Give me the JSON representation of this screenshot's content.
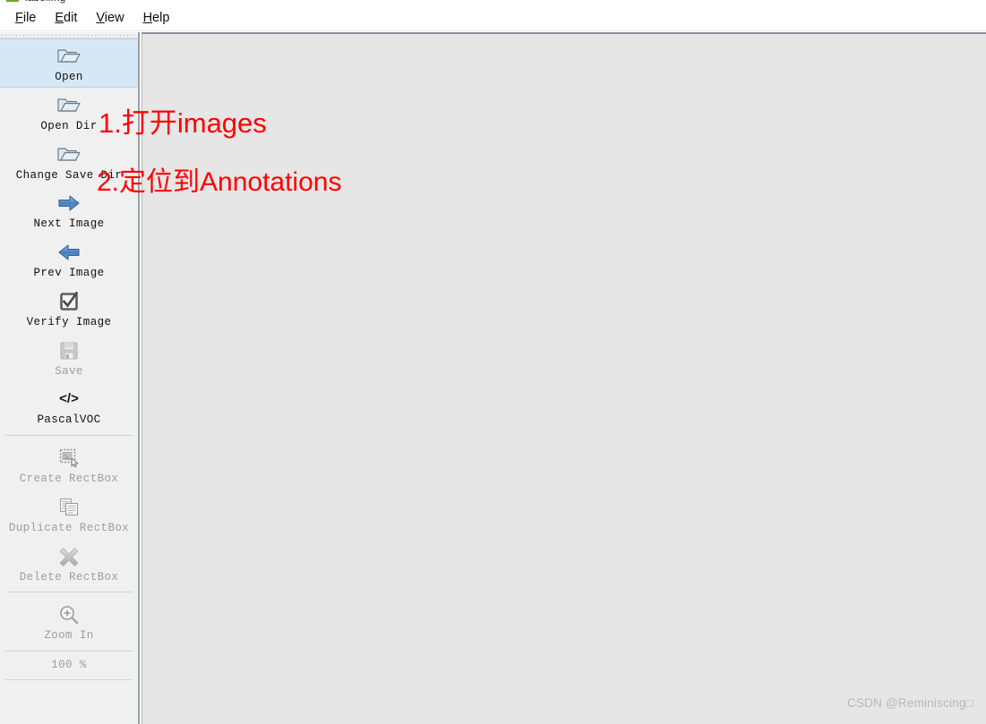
{
  "window": {
    "title": "labelImg",
    "icon": "labelimg-logo-icon"
  },
  "menubar": {
    "items": [
      {
        "label": "File",
        "mnemonic": "F"
      },
      {
        "label": "Edit",
        "mnemonic": "E"
      },
      {
        "label": "View",
        "mnemonic": "V"
      },
      {
        "label": "Help",
        "mnemonic": "H"
      }
    ]
  },
  "toolbar": {
    "items": [
      {
        "label": "Open",
        "icon": "open-folder-icon",
        "enabled": true,
        "selected": true
      },
      {
        "label": "Open Dir",
        "icon": "open-folder-icon",
        "enabled": true,
        "selected": false
      },
      {
        "label": "Change Save Dir",
        "icon": "open-folder-icon",
        "enabled": true,
        "selected": false
      },
      {
        "label": "Next Image",
        "icon": "arrow-right-icon",
        "enabled": true,
        "selected": false
      },
      {
        "label": "Prev Image",
        "icon": "arrow-left-icon",
        "enabled": true,
        "selected": false
      },
      {
        "label": "Verify Image",
        "icon": "checkbox-checked-icon",
        "enabled": true,
        "selected": false
      },
      {
        "label": "Save",
        "icon": "floppy-disk-icon",
        "enabled": false,
        "selected": false
      },
      {
        "label": "PascalVOC",
        "icon": "code-tag-icon",
        "enabled": true,
        "selected": false
      },
      {
        "label": "Create RectBox",
        "icon": "create-rectbox-icon",
        "enabled": false,
        "selected": false
      },
      {
        "label": "Duplicate RectBox",
        "icon": "duplicate-icon",
        "enabled": false,
        "selected": false
      },
      {
        "label": "Delete RectBox",
        "icon": "delete-x-icon",
        "enabled": false,
        "selected": false
      },
      {
        "label": "Zoom In",
        "icon": "zoom-in-icon",
        "enabled": false,
        "selected": false
      }
    ],
    "separator_before": [
      8,
      11
    ],
    "zoom_value": "100 %"
  },
  "annotations": [
    {
      "text": "1.打开images"
    },
    {
      "text": "2.定位到Annotations"
    }
  ],
  "watermark": {
    "text": "CSDN @Reminiscing□"
  },
  "colors": {
    "annotation_red": "#fe0000",
    "toolbar_bg": "#f0f0f0",
    "selected_bg": "#d6e8f5",
    "canvas_bg": "#e6e6e6",
    "disabled_text": "#9e9e9e",
    "watermark_text": "#b9b9b9"
  }
}
